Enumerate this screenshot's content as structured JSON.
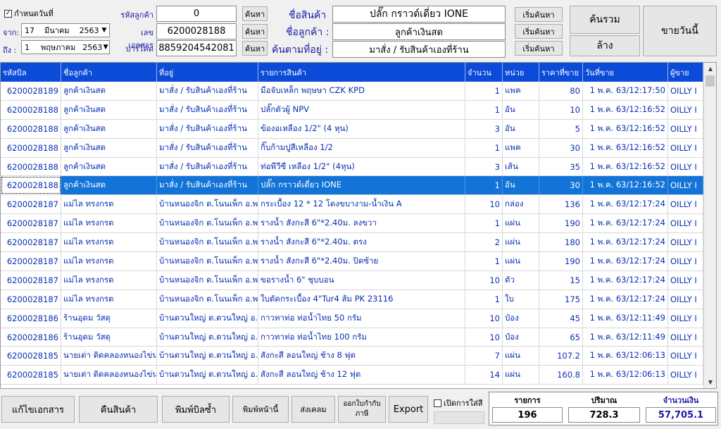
{
  "filters": {
    "date_check_label": "กำหนดวันที่",
    "date_checked": true,
    "from_label": "จาก:",
    "to_label": "ถึง :",
    "from_day": "17",
    "from_month": "มีนาคม",
    "from_year": "2563",
    "to_day": "1",
    "to_month": "พฤษภาคม",
    "to_year": "2563"
  },
  "search": {
    "customer_code_label": "รหัสลูกค้า",
    "customer_code_value": "0",
    "doc_no_label": "เลขเอกสาร",
    "doc_no_value": "6200028188",
    "barcode_label": "บาร์โค้ด",
    "barcode_value": "8859204542081",
    "find_label": "ค้นหา",
    "product_name_label": "ชื่อสินค้า",
    "product_name_value": "ปลั๊ก กราวด์เดี่ยว IONE",
    "customer_name_label": "ชื่อลูกค้า :",
    "customer_name_value": "ลูกค้าเงินสด",
    "address_label": "ค้นตามที่อยู่ :",
    "address_value": "มาสั่ง / รับสินค้าเองที่ร้าน",
    "start_search_label": "เริ่มค้นหา",
    "search_all_label": "ค้นรวม",
    "clear_label": "ล้าง",
    "sell_today_label": "ขายวันนี้"
  },
  "table": {
    "columns": [
      "รหัสบิล",
      "ชื่อลูกค้า",
      "ที่อยู่",
      "รายการสินค้า",
      "จำนวน",
      "หน่วย",
      "ราคาที่ขาย",
      "วันที่ขาย",
      "ผู้ขาย"
    ],
    "selected_index": 5,
    "rows": [
      [
        "6200028189",
        "ลูกค้าเงินสด",
        "มาสั่ง / รับสินค้าเองที่ร้าน",
        "มือจับเหล็ก พฤษษา CZK KPD",
        "1",
        "แพค",
        "80",
        "1 พ.ค. 63/12:17:50",
        "OILLY I"
      ],
      [
        "6200028188",
        "ลูกค้าเงินสด",
        "มาสั่ง / รับสินค้าเองที่ร้าน",
        "ปลั๊กตัวผู้ NPV",
        "1",
        "อัน",
        "10",
        "1 พ.ค. 63/12:16:52",
        "OILLY I"
      ],
      [
        "6200028188",
        "ลูกค้าเงินสด",
        "มาสั่ง / รับสินค้าเองที่ร้าน",
        "ข้องอเหลือง 1/2\" (4 หุน)",
        "3",
        "อัน",
        "5",
        "1 พ.ค. 63/12:16:52",
        "OILLY I"
      ],
      [
        "6200028188",
        "ลูกค้าเงินสด",
        "มาสั่ง / รับสินค้าเองที่ร้าน",
        "กิ๊บก้ามปูสีเหลือง 1/2",
        "1",
        "แพค",
        "30",
        "1 พ.ค. 63/12:16:52",
        "OILLY I"
      ],
      [
        "6200028188",
        "ลูกค้าเงินสด",
        "มาสั่ง / รับสินค้าเองที่ร้าน",
        "ท่อพีวีซี เหลือง 1/2\" (4หุน)",
        "3",
        "เส้น",
        "35",
        "1 พ.ค. 63/12:16:52",
        "OILLY I"
      ],
      [
        "6200028188",
        "ลูกค้าเงินสด",
        "มาสั่ง / รับสินค้าเองที่ร้าน",
        "ปลั๊ก กราวด์เดี่ยว IONE",
        "1",
        "อัน",
        "30",
        "1 พ.ค. 63/12:16:52",
        "OILLY I"
      ],
      [
        "6200028187",
        "แม่ไล ทรงกรต",
        "บ้านหนองจิก ต.โนนเพ็ก อ.พยุห์",
        "กระเบื้อง 12 * 12 โดงขบางาม-น้ำเงิน A",
        "10",
        "กล่อง",
        "136",
        "1 พ.ค. 63/12:17:24",
        "OILLY I"
      ],
      [
        "6200028187",
        "แม่ไล ทรงกรต",
        "บ้านหนองจิก ต.โนนเพ็ก อ.พยุห์",
        "รางน้ำ สังกะสี 6\"*2.40ม. ลงขวา",
        "1",
        "แผ่น",
        "190",
        "1 พ.ค. 63/12:17:24",
        "OILLY I"
      ],
      [
        "6200028187",
        "แม่ไล ทรงกรต",
        "บ้านหนองจิก ต.โนนเพ็ก อ.พยุห์",
        "รางน้ำ สังกะสี 6\"*2.40ม. ตรง",
        "2",
        "แผ่น",
        "180",
        "1 พ.ค. 63/12:17:24",
        "OILLY I"
      ],
      [
        "6200028187",
        "แม่ไล ทรงกรต",
        "บ้านหนองจิก ต.โนนเพ็ก อ.พยุห์",
        "รางน้ำ สังกะสี 6\"*2.40ม. ปิดซ้าย",
        "1",
        "แผ่น",
        "190",
        "1 พ.ค. 63/12:17:24",
        "OILLY I"
      ],
      [
        "6200028187",
        "แม่ไล ทรงกรต",
        "บ้านหนองจิก ต.โนนเพ็ก อ.พยุห์",
        "ขอรางน้ำ 6\" ชุบบอน",
        "10",
        "ตัว",
        "15",
        "1 พ.ค. 63/12:17:24",
        "OILLY I"
      ],
      [
        "6200028187",
        "แม่ไล ทรงกรต",
        "บ้านหนองจิก ต.โนนเพ็ก อ.พยุห์",
        "ใบตัดกระเบื้อง 4\"Tur4 ส้ม PK 23116",
        "1",
        "ใบ",
        "175",
        "1 พ.ค. 63/12:17:24",
        "OILLY I"
      ],
      [
        "6200028186",
        "ร้านอุดม วัสดุ",
        "บ้านตวนใหญ่ ต.ตวนใหญ่ อ.วัง",
        "กาวทาท่อ ท่อน้ำไทย 50 กรัม",
        "10",
        "ป๋อง",
        "45",
        "1 พ.ค. 63/12:11:49",
        "OILLY I"
      ],
      [
        "6200028186",
        "ร้านอุดม วัสดุ",
        "บ้านตวนใหญ่ ต.ตวนใหญ่ อ.วัง",
        "กาวทาท่อ ท่อน้ำไทย 100 กรัม",
        "10",
        "ป๋อง",
        "65",
        "1 พ.ค. 63/12:11:49",
        "OILLY I"
      ],
      [
        "6200028185",
        "นายเต่า ติดคลองหนองไข่นก",
        "บ้านตวนใหญ่ ต.ตวนใหญ่ อ.วัง",
        "สังกะสี ลอนใหญ่ ช้าง 8 ฟุต",
        "7",
        "แผ่น",
        "107.2",
        "1 พ.ค. 63/12:06:13",
        "OILLY I"
      ],
      [
        "6200028185",
        "นายเต่า ติดคลองหนองไข่นก",
        "บ้านตวนใหญ่ ต.ตวนใหญ่ อ.วัง",
        "สังกะสี ลอนใหญ่ ช้าง 12 ฟุต",
        "14",
        "แผ่น",
        "160.8",
        "1 พ.ค. 63/12:06:13",
        "OILLY I"
      ]
    ]
  },
  "footer": {
    "edit_doc_label": "แก้ไขเอกสาร",
    "return_label": "คืนสินค้า",
    "reprint_label": "พิมพ์บิลซ้ำ",
    "print_page_label": "พิมพ์หน้านี้",
    "send_claim_label": "ส่งเคลม",
    "tax_invoice_label_1": "ออกใบกำกับ",
    "tax_invoice_label_2": "ภาษี",
    "export_label": "Export",
    "open_fill_label": "เปิดการใส่สี",
    "items_label": "รายการ",
    "items_value": "196",
    "quantity_label": "ปริมาณ",
    "quantity_value": "728.3",
    "amount_label": "จำนวนเงิน",
    "amount_value": "57,705.1"
  }
}
